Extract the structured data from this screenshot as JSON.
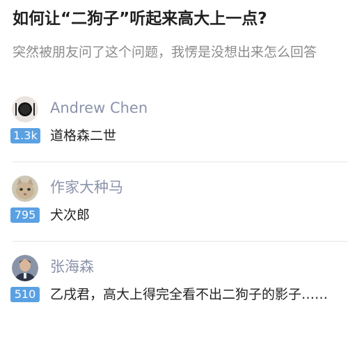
{
  "question": {
    "title": "如何让“二狗子”听起来高大上一点?",
    "description": "突然被朋友问了这个问题，我愣是没想出来怎么回答"
  },
  "answers": [
    {
      "author": "Andrew Chen",
      "votes": "1.3k",
      "excerpt": "道格森二世",
      "avatar_icon": "plate-cutlery-icon"
    },
    {
      "author": "作家大种马",
      "votes": "795",
      "excerpt": "犬次郎",
      "avatar_icon": "cat-face-icon"
    },
    {
      "author": "张海森",
      "votes": "510",
      "excerpt": "乙戌君，高大上得完全看不出二狗子的影子……",
      "avatar_icon": "person-photo-icon"
    }
  ],
  "colors": {
    "vote_badge": "#5aa1e3",
    "author_name": "#8b93aa",
    "description": "#8b8b8b"
  }
}
